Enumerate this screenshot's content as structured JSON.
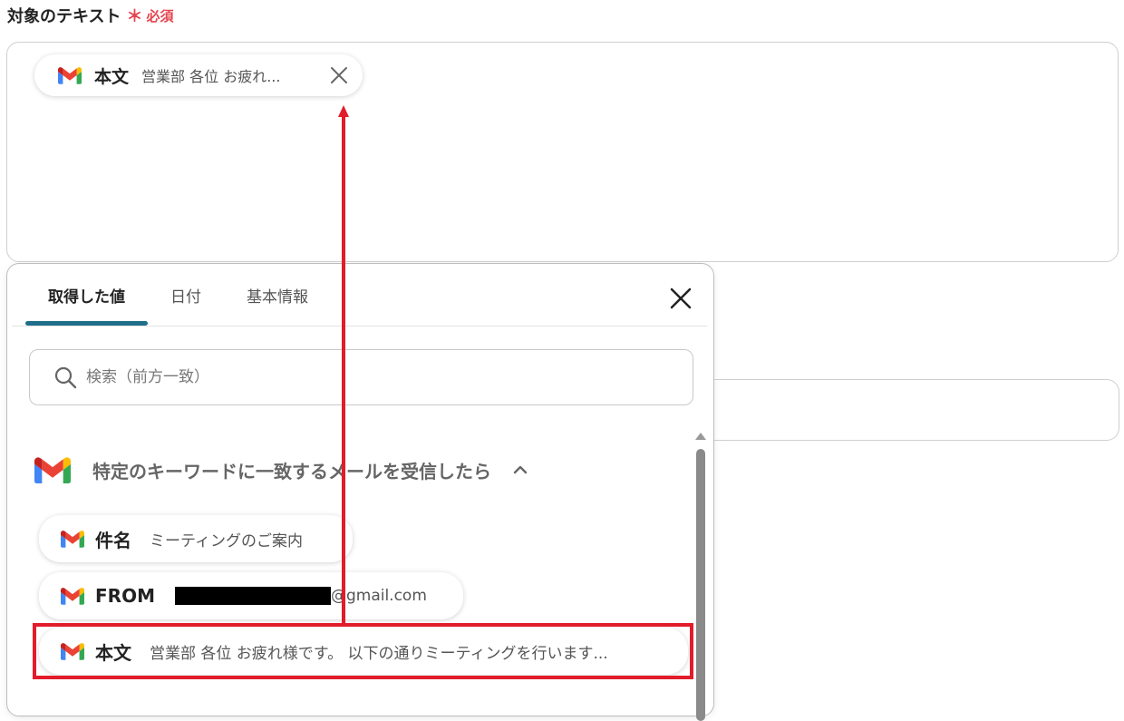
{
  "field": {
    "label": "対象のテキスト",
    "required_mark": "＊",
    "required_text": "必須",
    "selected_chip": {
      "label": "本文",
      "value": "営業部 各位 お疲れ..."
    }
  },
  "popup": {
    "tabs": [
      {
        "label": "取得した値",
        "active": true
      },
      {
        "label": "日付",
        "active": false
      },
      {
        "label": "基本情報",
        "active": false
      }
    ],
    "search": {
      "placeholder": "検索（前方一致）"
    },
    "section": {
      "title": "特定のキーワードに一致するメールを受信したら"
    },
    "items": [
      {
        "label": "件名",
        "value": "ミーティングのご案内"
      },
      {
        "label": "FROM",
        "value": "@gmail.com"
      },
      {
        "label": "本文",
        "value": "営業部 各位 お疲れ様です。 以下の通りミーティングを行います..."
      }
    ]
  },
  "colors": {
    "required": "#e5454f",
    "tab_indicator": "#1f6f8b",
    "annotation": "#e21c2a"
  }
}
